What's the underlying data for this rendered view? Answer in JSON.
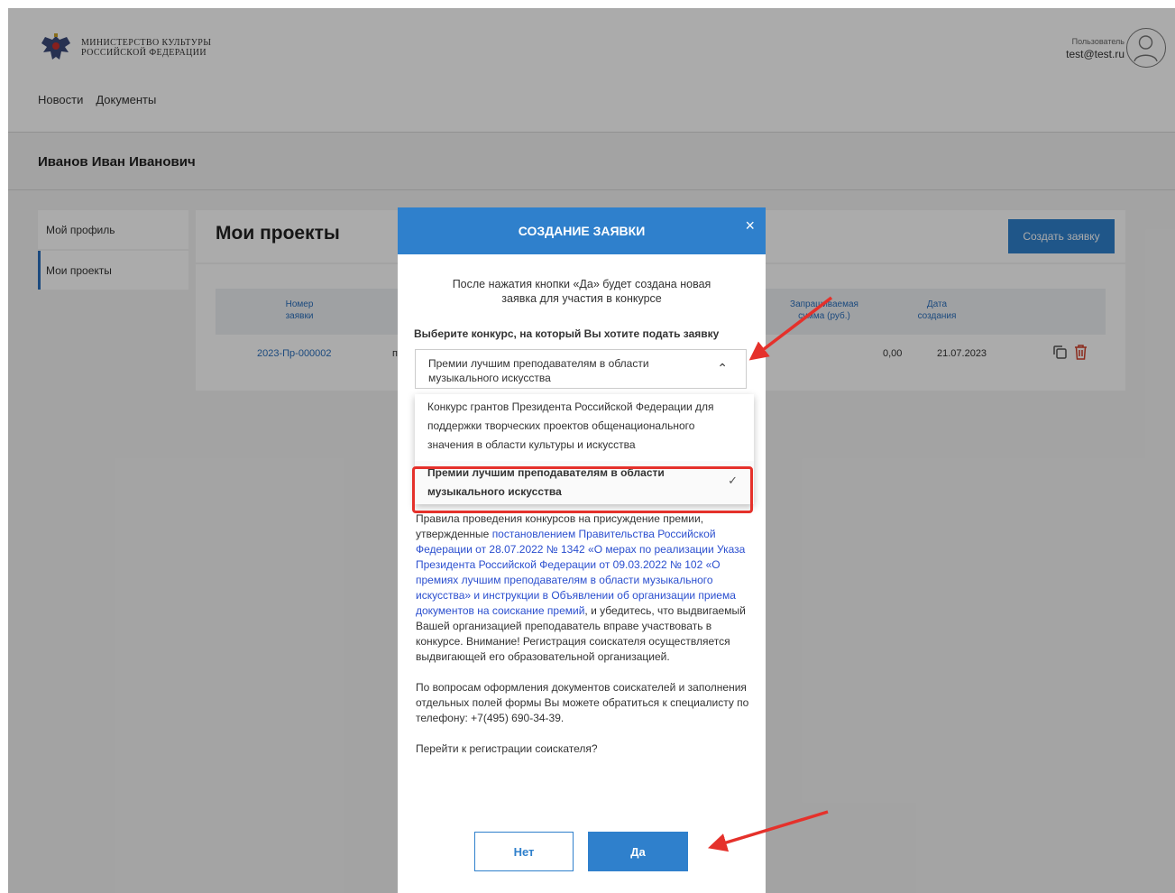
{
  "header": {
    "logo_line1": "МИНИСТЕРСТВО КУЛЬТУРЫ",
    "logo_line2": "РОССИЙСКОЙ ФЕДЕРАЦИИ",
    "nav": [
      "Новости",
      "Документы"
    ],
    "user_label": "Пользователь",
    "user_email": "test@test.ru"
  },
  "page": {
    "user_name": "Иванов Иван Иванович",
    "sidebar": [
      "Мой профиль",
      "Мои проекты"
    ],
    "projects_title": "Мои проекты",
    "create_button": "Создать заявку",
    "table": {
      "headers": [
        "Номер\nзаявки",
        "Запрашиваемая\nсумма (руб.)",
        "Дата\nсоздания"
      ],
      "row": {
        "number": "2023-Пр-000002",
        "prefix": "п",
        "amount": "0,00",
        "date": "21.07.2023"
      }
    }
  },
  "modal": {
    "title": "СОЗДАНИЕ ЗАЯВКИ",
    "close": "×",
    "intro": "После нажатия кнопки «Да» будет создана новая заявка для участия в конкурсе",
    "select_label": "Выберите конкурс, на который Вы хотите подать заявку",
    "selected_value": "Премии лучшим преподавателям в области музыкального искусства",
    "options": [
      "Конкурс грантов Президента Российской Федерации для поддержки творческих проектов общенационального значения в области культуры и искусства",
      "Премии лучшим преподавателям в области музыкального искусства"
    ],
    "text_p1_a": "Правила проведения конкурсов на присуждение премии, утвержденные ",
    "text_p1_link": "постановлением Правительства Российской Федерации от 28.07.2022 № 1342 «О мерах по реализации Указа Президента Российской Федерации от 09.03.2022 № 102 «О премиях лучшим преподавателям в области музыкального искусства» и инструкции в Объявлении об организации приема документов на соискание премий",
    "text_p1_b": ", и убедитесь, что выдвигаемый Вашей организацией преподаватель вправе участвовать в конкурсе. Внимание! Регистрация соискателя осуществляется выдвигающей его образовательной организацией.",
    "text_p2": "По вопросам оформления документов соискателей и заполнения отдельных полей формы Вы можете обратиться к специалисту по телефону: +7(495) 690-34-39.",
    "text_p3": "Перейти к регистрации соискателя?",
    "btn_no": "Нет",
    "btn_yes": "Да"
  },
  "colors": {
    "accent": "#2f80cc",
    "annotation": "#e5312b",
    "link": "#2b4fcf"
  }
}
